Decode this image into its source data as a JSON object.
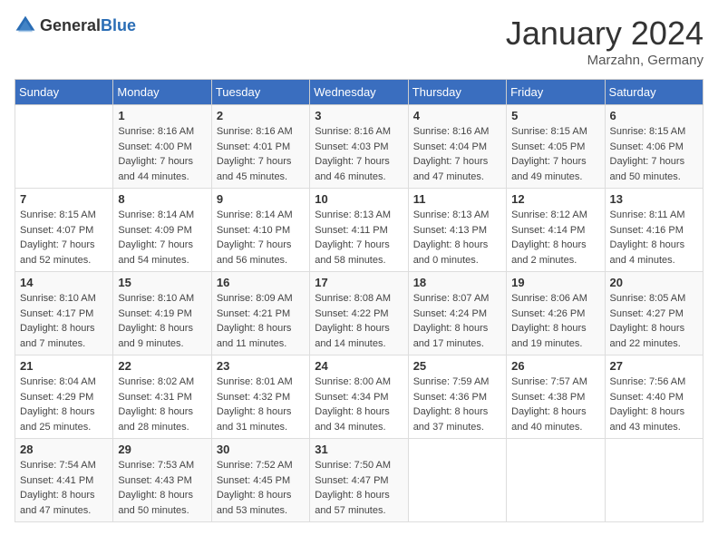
{
  "header": {
    "logo_general": "General",
    "logo_blue": "Blue",
    "month_title": "January 2024",
    "location": "Marzahn, Germany"
  },
  "days_of_week": [
    "Sunday",
    "Monday",
    "Tuesday",
    "Wednesday",
    "Thursday",
    "Friday",
    "Saturday"
  ],
  "weeks": [
    [
      {
        "day": "",
        "sunrise": "",
        "sunset": "",
        "daylight": ""
      },
      {
        "day": "1",
        "sunrise": "Sunrise: 8:16 AM",
        "sunset": "Sunset: 4:00 PM",
        "daylight": "Daylight: 7 hours and 44 minutes."
      },
      {
        "day": "2",
        "sunrise": "Sunrise: 8:16 AM",
        "sunset": "Sunset: 4:01 PM",
        "daylight": "Daylight: 7 hours and 45 minutes."
      },
      {
        "day": "3",
        "sunrise": "Sunrise: 8:16 AM",
        "sunset": "Sunset: 4:03 PM",
        "daylight": "Daylight: 7 hours and 46 minutes."
      },
      {
        "day": "4",
        "sunrise": "Sunrise: 8:16 AM",
        "sunset": "Sunset: 4:04 PM",
        "daylight": "Daylight: 7 hours and 47 minutes."
      },
      {
        "day": "5",
        "sunrise": "Sunrise: 8:15 AM",
        "sunset": "Sunset: 4:05 PM",
        "daylight": "Daylight: 7 hours and 49 minutes."
      },
      {
        "day": "6",
        "sunrise": "Sunrise: 8:15 AM",
        "sunset": "Sunset: 4:06 PM",
        "daylight": "Daylight: 7 hours and 50 minutes."
      }
    ],
    [
      {
        "day": "7",
        "sunrise": "Sunrise: 8:15 AM",
        "sunset": "Sunset: 4:07 PM",
        "daylight": "Daylight: 7 hours and 52 minutes."
      },
      {
        "day": "8",
        "sunrise": "Sunrise: 8:14 AM",
        "sunset": "Sunset: 4:09 PM",
        "daylight": "Daylight: 7 hours and 54 minutes."
      },
      {
        "day": "9",
        "sunrise": "Sunrise: 8:14 AM",
        "sunset": "Sunset: 4:10 PM",
        "daylight": "Daylight: 7 hours and 56 minutes."
      },
      {
        "day": "10",
        "sunrise": "Sunrise: 8:13 AM",
        "sunset": "Sunset: 4:11 PM",
        "daylight": "Daylight: 7 hours and 58 minutes."
      },
      {
        "day": "11",
        "sunrise": "Sunrise: 8:13 AM",
        "sunset": "Sunset: 4:13 PM",
        "daylight": "Daylight: 8 hours and 0 minutes."
      },
      {
        "day": "12",
        "sunrise": "Sunrise: 8:12 AM",
        "sunset": "Sunset: 4:14 PM",
        "daylight": "Daylight: 8 hours and 2 minutes."
      },
      {
        "day": "13",
        "sunrise": "Sunrise: 8:11 AM",
        "sunset": "Sunset: 4:16 PM",
        "daylight": "Daylight: 8 hours and 4 minutes."
      }
    ],
    [
      {
        "day": "14",
        "sunrise": "Sunrise: 8:10 AM",
        "sunset": "Sunset: 4:17 PM",
        "daylight": "Daylight: 8 hours and 7 minutes."
      },
      {
        "day": "15",
        "sunrise": "Sunrise: 8:10 AM",
        "sunset": "Sunset: 4:19 PM",
        "daylight": "Daylight: 8 hours and 9 minutes."
      },
      {
        "day": "16",
        "sunrise": "Sunrise: 8:09 AM",
        "sunset": "Sunset: 4:21 PM",
        "daylight": "Daylight: 8 hours and 11 minutes."
      },
      {
        "day": "17",
        "sunrise": "Sunrise: 8:08 AM",
        "sunset": "Sunset: 4:22 PM",
        "daylight": "Daylight: 8 hours and 14 minutes."
      },
      {
        "day": "18",
        "sunrise": "Sunrise: 8:07 AM",
        "sunset": "Sunset: 4:24 PM",
        "daylight": "Daylight: 8 hours and 17 minutes."
      },
      {
        "day": "19",
        "sunrise": "Sunrise: 8:06 AM",
        "sunset": "Sunset: 4:26 PM",
        "daylight": "Daylight: 8 hours and 19 minutes."
      },
      {
        "day": "20",
        "sunrise": "Sunrise: 8:05 AM",
        "sunset": "Sunset: 4:27 PM",
        "daylight": "Daylight: 8 hours and 22 minutes."
      }
    ],
    [
      {
        "day": "21",
        "sunrise": "Sunrise: 8:04 AM",
        "sunset": "Sunset: 4:29 PM",
        "daylight": "Daylight: 8 hours and 25 minutes."
      },
      {
        "day": "22",
        "sunrise": "Sunrise: 8:02 AM",
        "sunset": "Sunset: 4:31 PM",
        "daylight": "Daylight: 8 hours and 28 minutes."
      },
      {
        "day": "23",
        "sunrise": "Sunrise: 8:01 AM",
        "sunset": "Sunset: 4:32 PM",
        "daylight": "Daylight: 8 hours and 31 minutes."
      },
      {
        "day": "24",
        "sunrise": "Sunrise: 8:00 AM",
        "sunset": "Sunset: 4:34 PM",
        "daylight": "Daylight: 8 hours and 34 minutes."
      },
      {
        "day": "25",
        "sunrise": "Sunrise: 7:59 AM",
        "sunset": "Sunset: 4:36 PM",
        "daylight": "Daylight: 8 hours and 37 minutes."
      },
      {
        "day": "26",
        "sunrise": "Sunrise: 7:57 AM",
        "sunset": "Sunset: 4:38 PM",
        "daylight": "Daylight: 8 hours and 40 minutes."
      },
      {
        "day": "27",
        "sunrise": "Sunrise: 7:56 AM",
        "sunset": "Sunset: 4:40 PM",
        "daylight": "Daylight: 8 hours and 43 minutes."
      }
    ],
    [
      {
        "day": "28",
        "sunrise": "Sunrise: 7:54 AM",
        "sunset": "Sunset: 4:41 PM",
        "daylight": "Daylight: 8 hours and 47 minutes."
      },
      {
        "day": "29",
        "sunrise": "Sunrise: 7:53 AM",
        "sunset": "Sunset: 4:43 PM",
        "daylight": "Daylight: 8 hours and 50 minutes."
      },
      {
        "day": "30",
        "sunrise": "Sunrise: 7:52 AM",
        "sunset": "Sunset: 4:45 PM",
        "daylight": "Daylight: 8 hours and 53 minutes."
      },
      {
        "day": "31",
        "sunrise": "Sunrise: 7:50 AM",
        "sunset": "Sunset: 4:47 PM",
        "daylight": "Daylight: 8 hours and 57 minutes."
      },
      {
        "day": "",
        "sunrise": "",
        "sunset": "",
        "daylight": ""
      },
      {
        "day": "",
        "sunrise": "",
        "sunset": "",
        "daylight": ""
      },
      {
        "day": "",
        "sunrise": "",
        "sunset": "",
        "daylight": ""
      }
    ]
  ]
}
